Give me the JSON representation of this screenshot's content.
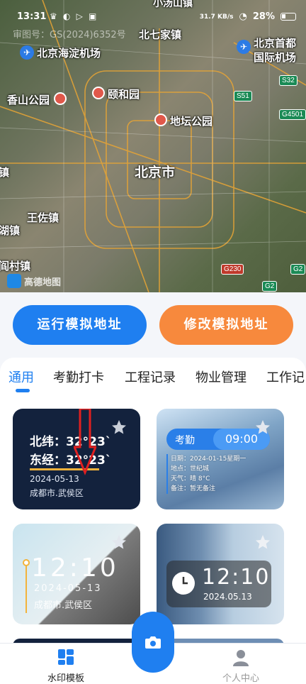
{
  "status_bar": {
    "time": "13:31",
    "net_speed": "31.7 KB/s",
    "battery": "28%"
  },
  "map": {
    "review_no": "审图号：GS(2024)6352号",
    "labels": {
      "north_seven": "北七家镇",
      "haidian_airport": "北京海淀机场",
      "capital_airport_1": "北京首都",
      "capital_airport_2": "国际机场",
      "xiangshan": "香山公园",
      "yiheyuan": "颐和园",
      "ditan": "地坛公园",
      "beijing": "北京市",
      "wangzuo": "王佐镇",
      "left_edge_1": "镇",
      "left_edge_2": "湖镇",
      "left_edge_3": "阎村镇",
      "top_cut": "小汤山镇"
    },
    "shields": [
      "S32",
      "S51",
      "G4501",
      "G230",
      "G2",
      "G2"
    ],
    "provider": "高德地图"
  },
  "actions": {
    "run_mock": "运行模拟地址",
    "edit_mock": "修改模拟地址"
  },
  "tabs": [
    "通用",
    "考勤打卡",
    "工程记录",
    "物业管理",
    "工作记"
  ],
  "cards": {
    "c1": {
      "lat": "北纬：32°23`",
      "lng": "东经：32°23`",
      "date": "2024-05-13",
      "location": "成都市.武侯区"
    },
    "c2": {
      "label": "考勤",
      "time": "09:00",
      "info": [
        "日期：2024-01-15星期一",
        "地点：世纪城",
        "天气：晴 8°C",
        "备注：暂无备注"
      ]
    },
    "c3": {
      "time": "12:10",
      "date": "2024-05-13",
      "location": "成都市.武侯区"
    },
    "c4": {
      "time": "12:10",
      "date": "2024.05.13"
    }
  },
  "bottom_nav": {
    "templates": "水印模板",
    "profile": "个人中心"
  },
  "colors": {
    "primary": "#1f7ff0",
    "accent": "#f7893d",
    "navy": "#13223d"
  }
}
